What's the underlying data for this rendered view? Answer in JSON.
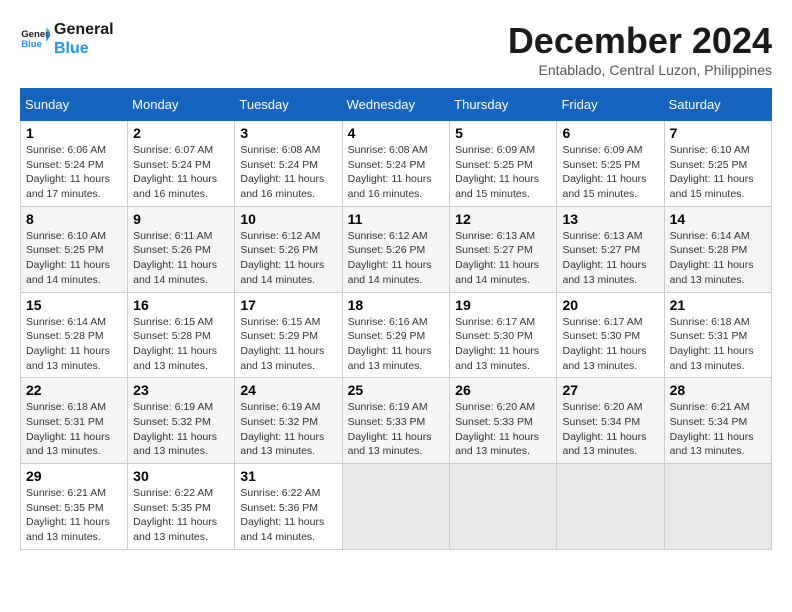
{
  "header": {
    "logo_line1": "General",
    "logo_line2": "Blue",
    "month": "December 2024",
    "location": "Entablado, Central Luzon, Philippines"
  },
  "weekdays": [
    "Sunday",
    "Monday",
    "Tuesday",
    "Wednesday",
    "Thursday",
    "Friday",
    "Saturday"
  ],
  "weeks": [
    [
      {
        "day": "1",
        "sunrise": "6:06 AM",
        "sunset": "5:24 PM",
        "daylight": "11 hours and 17 minutes."
      },
      {
        "day": "2",
        "sunrise": "6:07 AM",
        "sunset": "5:24 PM",
        "daylight": "11 hours and 16 minutes."
      },
      {
        "day": "3",
        "sunrise": "6:08 AM",
        "sunset": "5:24 PM",
        "daylight": "11 hours and 16 minutes."
      },
      {
        "day": "4",
        "sunrise": "6:08 AM",
        "sunset": "5:24 PM",
        "daylight": "11 hours and 16 minutes."
      },
      {
        "day": "5",
        "sunrise": "6:09 AM",
        "sunset": "5:25 PM",
        "daylight": "11 hours and 15 minutes."
      },
      {
        "day": "6",
        "sunrise": "6:09 AM",
        "sunset": "5:25 PM",
        "daylight": "11 hours and 15 minutes."
      },
      {
        "day": "7",
        "sunrise": "6:10 AM",
        "sunset": "5:25 PM",
        "daylight": "11 hours and 15 minutes."
      }
    ],
    [
      {
        "day": "8",
        "sunrise": "6:10 AM",
        "sunset": "5:25 PM",
        "daylight": "11 hours and 14 minutes."
      },
      {
        "day": "9",
        "sunrise": "6:11 AM",
        "sunset": "5:26 PM",
        "daylight": "11 hours and 14 minutes."
      },
      {
        "day": "10",
        "sunrise": "6:12 AM",
        "sunset": "5:26 PM",
        "daylight": "11 hours and 14 minutes."
      },
      {
        "day": "11",
        "sunrise": "6:12 AM",
        "sunset": "5:26 PM",
        "daylight": "11 hours and 14 minutes."
      },
      {
        "day": "12",
        "sunrise": "6:13 AM",
        "sunset": "5:27 PM",
        "daylight": "11 hours and 14 minutes."
      },
      {
        "day": "13",
        "sunrise": "6:13 AM",
        "sunset": "5:27 PM",
        "daylight": "11 hours and 13 minutes."
      },
      {
        "day": "14",
        "sunrise": "6:14 AM",
        "sunset": "5:28 PM",
        "daylight": "11 hours and 13 minutes."
      }
    ],
    [
      {
        "day": "15",
        "sunrise": "6:14 AM",
        "sunset": "5:28 PM",
        "daylight": "11 hours and 13 minutes."
      },
      {
        "day": "16",
        "sunrise": "6:15 AM",
        "sunset": "5:28 PM",
        "daylight": "11 hours and 13 minutes."
      },
      {
        "day": "17",
        "sunrise": "6:15 AM",
        "sunset": "5:29 PM",
        "daylight": "11 hours and 13 minutes."
      },
      {
        "day": "18",
        "sunrise": "6:16 AM",
        "sunset": "5:29 PM",
        "daylight": "11 hours and 13 minutes."
      },
      {
        "day": "19",
        "sunrise": "6:17 AM",
        "sunset": "5:30 PM",
        "daylight": "11 hours and 13 minutes."
      },
      {
        "day": "20",
        "sunrise": "6:17 AM",
        "sunset": "5:30 PM",
        "daylight": "11 hours and 13 minutes."
      },
      {
        "day": "21",
        "sunrise": "6:18 AM",
        "sunset": "5:31 PM",
        "daylight": "11 hours and 13 minutes."
      }
    ],
    [
      {
        "day": "22",
        "sunrise": "6:18 AM",
        "sunset": "5:31 PM",
        "daylight": "11 hours and 13 minutes."
      },
      {
        "day": "23",
        "sunrise": "6:19 AM",
        "sunset": "5:32 PM",
        "daylight": "11 hours and 13 minutes."
      },
      {
        "day": "24",
        "sunrise": "6:19 AM",
        "sunset": "5:32 PM",
        "daylight": "11 hours and 13 minutes."
      },
      {
        "day": "25",
        "sunrise": "6:19 AM",
        "sunset": "5:33 PM",
        "daylight": "11 hours and 13 minutes."
      },
      {
        "day": "26",
        "sunrise": "6:20 AM",
        "sunset": "5:33 PM",
        "daylight": "11 hours and 13 minutes."
      },
      {
        "day": "27",
        "sunrise": "6:20 AM",
        "sunset": "5:34 PM",
        "daylight": "11 hours and 13 minutes."
      },
      {
        "day": "28",
        "sunrise": "6:21 AM",
        "sunset": "5:34 PM",
        "daylight": "11 hours and 13 minutes."
      }
    ],
    [
      {
        "day": "29",
        "sunrise": "6:21 AM",
        "sunset": "5:35 PM",
        "daylight": "11 hours and 13 minutes."
      },
      {
        "day": "30",
        "sunrise": "6:22 AM",
        "sunset": "5:35 PM",
        "daylight": "11 hours and 13 minutes."
      },
      {
        "day": "31",
        "sunrise": "6:22 AM",
        "sunset": "5:36 PM",
        "daylight": "11 hours and 14 minutes."
      },
      null,
      null,
      null,
      null
    ]
  ],
  "labels": {
    "sunrise_prefix": "Sunrise: ",
    "sunset_prefix": "Sunset: ",
    "daylight_prefix": "Daylight: "
  }
}
